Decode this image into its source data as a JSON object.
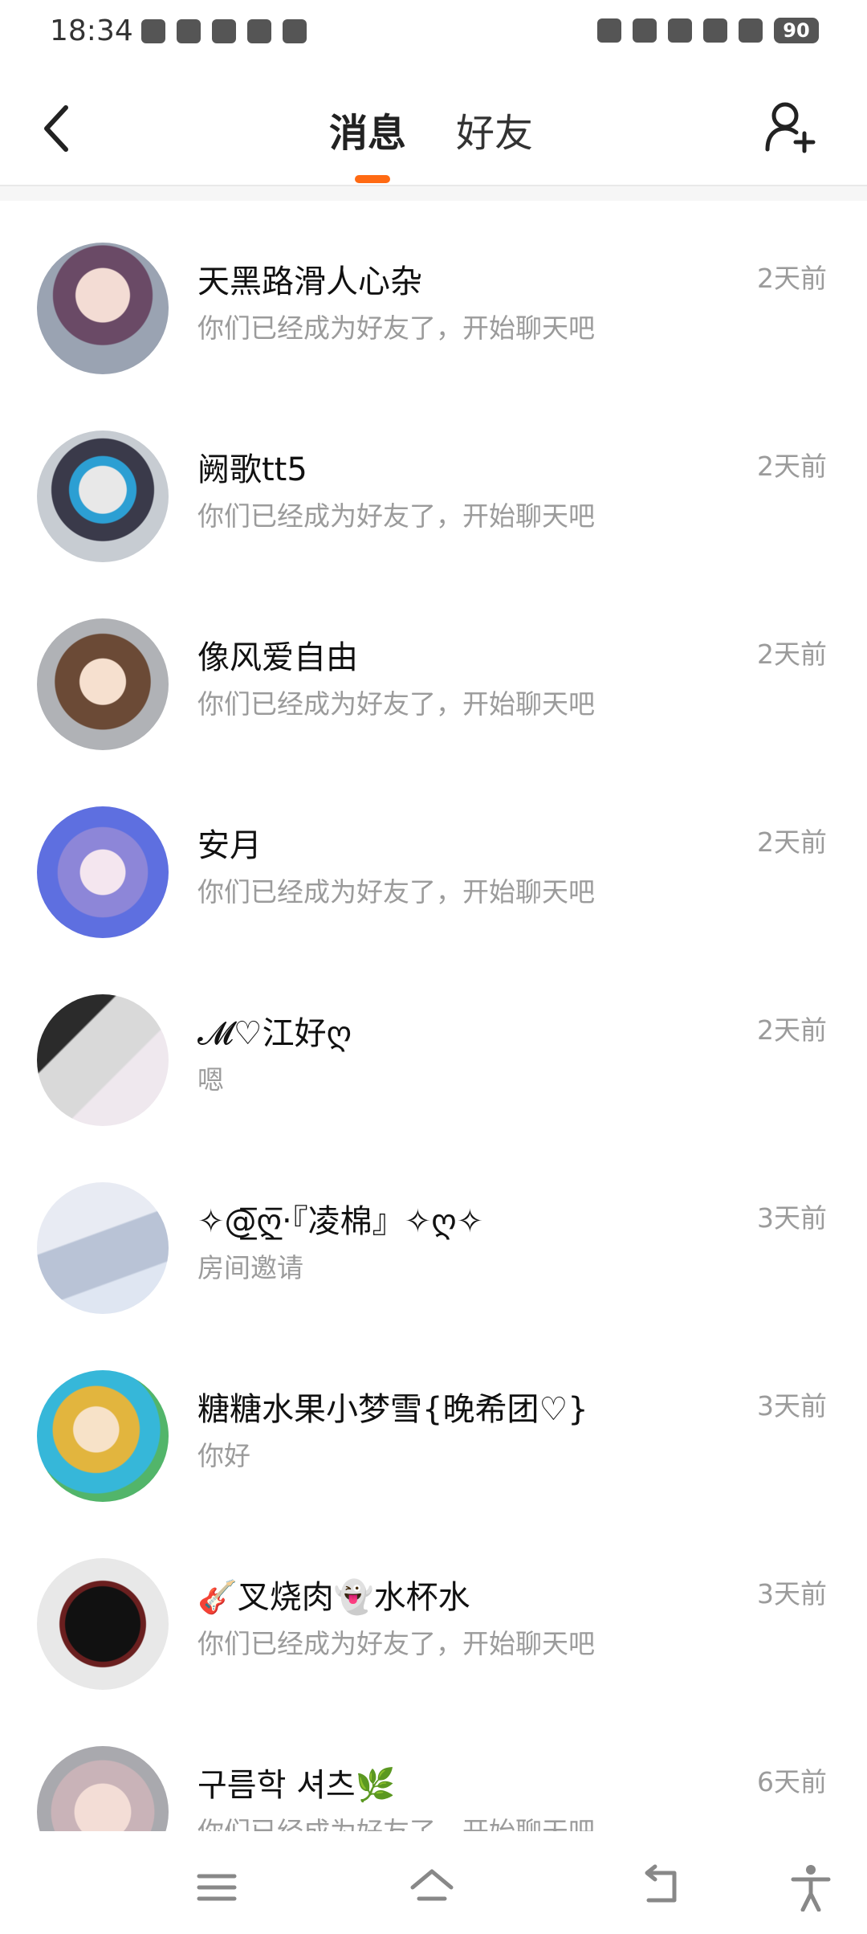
{
  "status_bar": {
    "time": "18:34",
    "battery": "90",
    "icons": [
      "gear-icon",
      "sync-icon",
      "cloud-icon",
      "mail-icon",
      "play-icon",
      "alarm-icon",
      "vibrate-icon",
      "hd-icon",
      "signal-icon",
      "wifi-icon"
    ]
  },
  "header": {
    "tabs": [
      {
        "label": "消息",
        "active": true
      },
      {
        "label": "好友",
        "active": false
      }
    ],
    "accent_color": "#ff6a13",
    "back_icon": "chevron-left-icon",
    "add_friend_icon": "add-user-icon"
  },
  "chats": [
    {
      "name": "天黑路滑人心杂",
      "preview": "你们已经成为好友了，开始聊天吧",
      "time": "2天前"
    },
    {
      "name": "阙歌tt5",
      "preview": "你们已经成为好友了，开始聊天吧",
      "time": "2天前"
    },
    {
      "name": "像风爱自由",
      "preview": "你们已经成为好友了，开始聊天吧",
      "time": "2天前"
    },
    {
      "name": "安月",
      "preview": "你们已经成为好友了，开始聊天吧",
      "time": "2天前"
    },
    {
      "name": "𝓜♡江好ღ",
      "preview": "嗯",
      "time": "2天前"
    },
    {
      "name": "✧@̲̅ღ̲̅‧『凌棉』✧ღ✧",
      "preview": "房间邀请",
      "time": "3天前"
    },
    {
      "name": "糖糖水果小梦雪{晚希团♡}",
      "preview": "你好",
      "time": "3天前"
    },
    {
      "name": "🎸叉烧肉👻水杯水",
      "preview": "你们已经成为好友了，开始聊天吧",
      "time": "3天前"
    },
    {
      "name": "구름학 셔츠🌿",
      "preview": "你们已经成为好友了，开始聊天吧",
      "time": "6天前"
    }
  ],
  "bottom_nav": [
    "menu-icon",
    "home-icon",
    "back-icon",
    "accessibility-icon"
  ]
}
